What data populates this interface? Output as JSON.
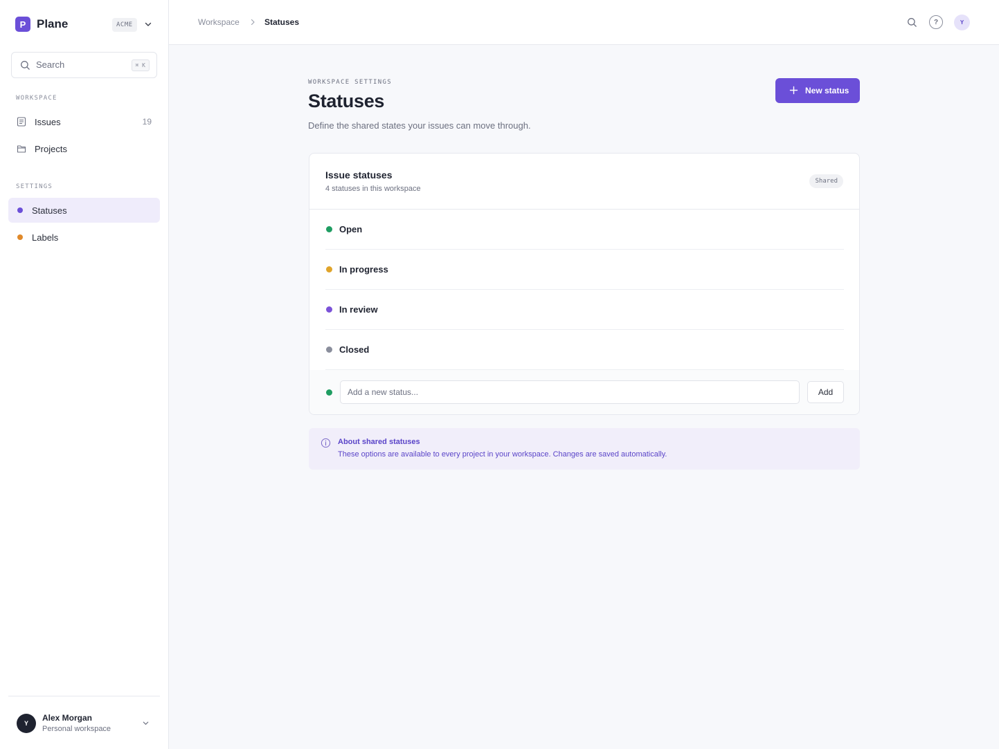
{
  "brand": {
    "logo_letter": "P",
    "name": "Plane",
    "workspace_badge": "ACME"
  },
  "search": {
    "placeholder": "Search",
    "shortcut": "⌘ K"
  },
  "sidebar": {
    "workspace_label": "WORKSPACE",
    "workspace_items": [
      {
        "label": "Issues",
        "count": "19",
        "icon": "document-icon"
      },
      {
        "label": "Projects",
        "icon": "folder-icon"
      }
    ],
    "settings_label": "SETTINGS",
    "settings_items": [
      {
        "label": "Statuses",
        "color": "#6b4fd8",
        "active": true
      },
      {
        "label": "Labels",
        "color": "#e0892a"
      }
    ]
  },
  "user": {
    "initial": "Y",
    "name": "Alex Morgan",
    "subtitle": "Personal workspace"
  },
  "topbar": {
    "breadcrumb": [
      "Workspace",
      "Statuses"
    ],
    "help_glyph": "?",
    "avatar_initial": "Y"
  },
  "page": {
    "eyebrow": "WORKSPACE SETTINGS",
    "title": "Statuses",
    "description": "Define the shared states your issues can move through.",
    "new_button": "New status"
  },
  "card": {
    "title": "Issue statuses",
    "subtitle": "4 statuses in this workspace",
    "badge": "Shared",
    "statuses": [
      {
        "name": "Open",
        "color": "#1f9d62"
      },
      {
        "name": "In progress",
        "color": "#e0a42a"
      },
      {
        "name": "In review",
        "color": "#7b52d8"
      },
      {
        "name": "Closed",
        "color": "#8a8e9c"
      }
    ],
    "add": {
      "placeholder": "Add a new status...",
      "button": "Add",
      "dot_color": "#1f9d62"
    }
  },
  "info": {
    "title": "About shared statuses",
    "text": "These options are available to every project in your workspace. Changes are saved automatically."
  },
  "colors": {
    "accent": "#6b4fd8",
    "info_bg": "#f1eefa",
    "info_text": "#5a44c8"
  }
}
